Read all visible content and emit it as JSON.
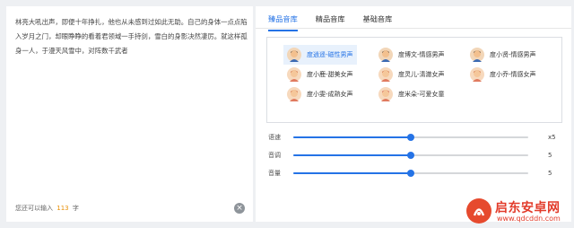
{
  "editor": {
    "text": "林亮大吼出声，即便十年挣扎，他也从未感到过如此无助。自己的身体一点点陷入岁月之门，却眼睁睁的看着君领域一手持剑，雪白的身影决然凄厉。就这样孤身一人，于漫天风雪中，对阵数千武者",
    "counter_prefix": "您还可以输入",
    "counter_value": "113",
    "counter_suffix": "字"
  },
  "tabs": [
    {
      "label": "臻品音库",
      "active": true
    },
    {
      "label": "精品音库",
      "active": false
    },
    {
      "label": "基础音库",
      "active": false
    }
  ],
  "voices": [
    {
      "label": "度逍遥-磁性男声",
      "gender": "male",
      "selected": true
    },
    {
      "label": "度博文-情感男声",
      "gender": "male",
      "selected": false
    },
    {
      "label": "度小贤-情感男声",
      "gender": "male",
      "selected": false
    },
    {
      "label": "度小鹿-甜美女声",
      "gender": "female",
      "selected": false
    },
    {
      "label": "度灵儿-清澈女声",
      "gender": "female",
      "selected": false
    },
    {
      "label": "度小乔-情感女声",
      "gender": "female",
      "selected": false
    },
    {
      "label": "度小雯-成熟女声",
      "gender": "female",
      "selected": false
    },
    {
      "label": "度米朵-可爱女童",
      "gender": "girl",
      "selected": false
    }
  ],
  "sliders": [
    {
      "label": "语速",
      "value": "x5",
      "level": 0.5
    },
    {
      "label": "音调",
      "value": "5",
      "level": 0.5
    },
    {
      "label": "音量",
      "value": "5",
      "level": 0.5
    }
  ],
  "watermark": {
    "title": "启东安卓网",
    "url": "www.qdcddn.com"
  },
  "colors": {
    "accent": "#2573e6",
    "counter": "#e8910a",
    "watermark": "#e23b2a"
  }
}
